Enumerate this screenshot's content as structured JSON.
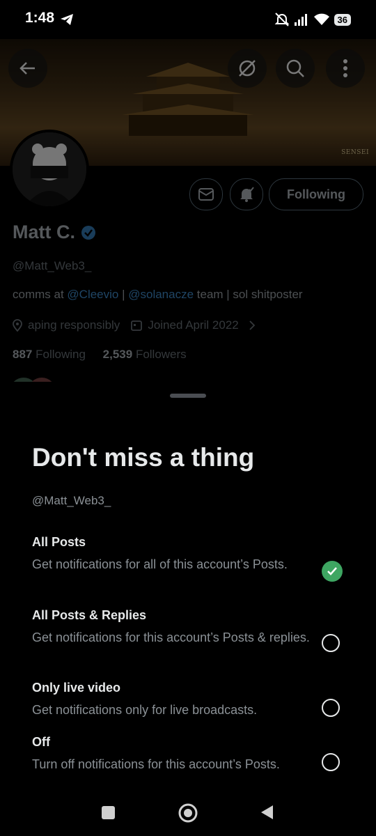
{
  "status_bar": {
    "time": "1:48",
    "battery": "36",
    "icons": [
      "telegram-icon",
      "mute-icon",
      "signal-icon",
      "wifi-icon",
      "battery-icon"
    ]
  },
  "profile": {
    "banner_watermark": "SENSEI",
    "name": "Matt C.",
    "handle": "@Matt_Web3_",
    "bio_prefix": "comms at ",
    "bio_link1": "@Cleevio",
    "bio_sep": " | ",
    "bio_link2": "@solanacze",
    "bio_suffix": " team | sol shitposter",
    "location": "aping responsibly",
    "joined": "Joined April 2022",
    "following_count": "887",
    "following_label": "Following",
    "followers_count": "2,539",
    "followers_label": "Followers",
    "follow_button": "Following"
  },
  "sheet": {
    "title": "Don't miss a thing",
    "handle": "@Matt_Web3_",
    "options": [
      {
        "title": "All Posts",
        "desc": "Get notifications for all of this account’s Posts.",
        "selected": true
      },
      {
        "title": "All Posts & Replies",
        "desc": "Get notifications for this account’s Posts & replies.",
        "selected": false
      },
      {
        "title": "Only live video",
        "desc": "Get notifications only for live broadcasts.",
        "selected": false
      },
      {
        "title": "Off",
        "desc": "Turn off notifications for this account’s Posts.",
        "selected": false
      }
    ]
  },
  "colors": {
    "accent_link": "#1d9bf0",
    "selected_green": "#3ea662",
    "background": "#000000"
  }
}
